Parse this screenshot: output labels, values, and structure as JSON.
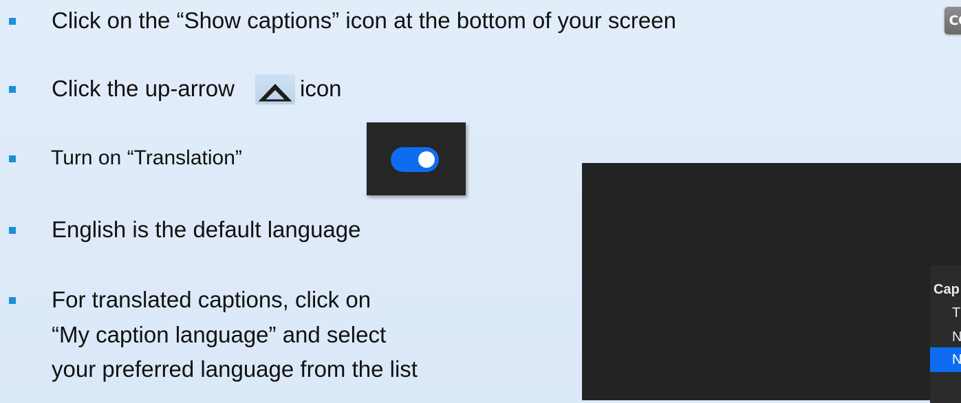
{
  "bullets": [
    {
      "text": "Click on the “Show captions” icon at the bottom of your screen"
    },
    {
      "text_before": "Click the up-arrow",
      "text_after": "icon"
    },
    {
      "text": "Turn on “Translation”"
    },
    {
      "text": "English is the default language"
    },
    {
      "lines": [
        "For translated captions, click on",
        "“My caption language” and select",
        "your preferred language from the list"
      ]
    }
  ],
  "cc_button": {
    "label": "CC",
    "icon": "closed-captions-icon"
  },
  "up_arrow": {
    "icon": "chevron-up-icon"
  },
  "translation_toggle": {
    "state": "on",
    "color": "#0e6cf0"
  },
  "caption_menu": {
    "title": "Cap",
    "items": [
      "T",
      "N",
      "N"
    ],
    "selected_index": 2,
    "selected_color": "#0e6cf0"
  },
  "colors": {
    "background": "#dce9f8",
    "bullet": "#1e8fd6",
    "panel": "#262626"
  }
}
